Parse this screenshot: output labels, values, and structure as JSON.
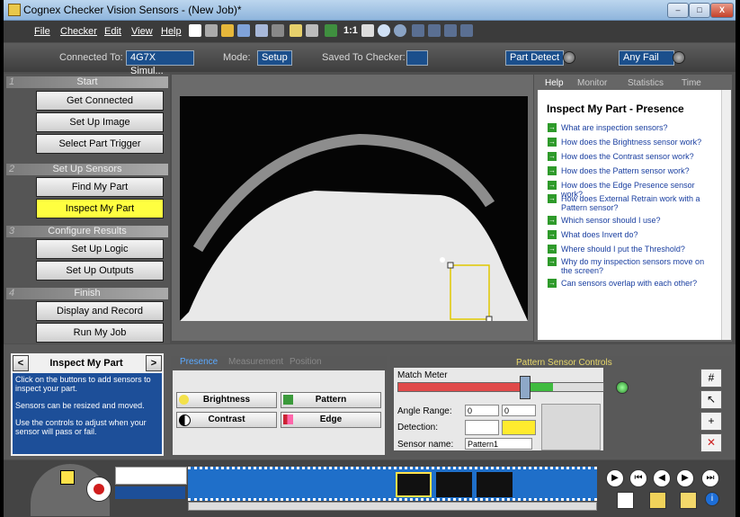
{
  "window": {
    "title": "Cognex Checker Vision Sensors - (New Job)*",
    "controls": [
      "–",
      "□",
      "X"
    ]
  },
  "menu": {
    "items": [
      "File",
      "Checker",
      "Edit",
      "View",
      "Help"
    ],
    "zoom_label": "1:1"
  },
  "status": {
    "connected_label": "Connected To:",
    "connected_value": "4G7X Simul...",
    "mode_label": "Mode:",
    "mode_value": "Setup",
    "saved_label": "Saved To Checker:",
    "saved_value": "",
    "part_detect": "Part Detect",
    "any_fail": "Any Fail"
  },
  "steps": [
    {
      "num": "1",
      "title": "Start",
      "buttons": [
        "Get Connected",
        "Set Up Image",
        "Select Part Trigger"
      ]
    },
    {
      "num": "2",
      "title": "Set Up Sensors",
      "buttons": [
        "Find My Part",
        "Inspect My Part"
      ]
    },
    {
      "num": "3",
      "title": "Configure Results",
      "buttons": [
        "Set Up Logic",
        "Set Up Outputs"
      ]
    },
    {
      "num": "4",
      "title": "Finish",
      "buttons": [
        "Display and Record",
        "Run My Job"
      ]
    }
  ],
  "right_tabs": [
    "Help",
    "Monitor",
    "Statistics",
    "Time"
  ],
  "help": {
    "title": "Inspect My Part - Presence",
    "links": [
      "What are inspection sensors?",
      "How does the Brightness sensor work?",
      "How does the Contrast sensor work?",
      "How does the Pattern sensor work?",
      "How does the Edge Presence sensor work?",
      "How does External Retrain work with a Pattern sensor?",
      "Which sensor should I use?",
      "What does Invert do?",
      "Where should I put the Threshold?",
      "Why do my inspection sensors move on the screen?",
      "Can sensors overlap with each other?"
    ]
  },
  "nav": {
    "prev": "<",
    "next": ">",
    "title": "Inspect My Part",
    "desc": [
      "Click on the buttons to add sensors to inspect your part.",
      "Sensors can be resized and moved.",
      "Use the controls to adjust when your sensor will pass or fail."
    ]
  },
  "sensor_tabs": [
    "Presence",
    "Measurement",
    "Position"
  ],
  "sensors": [
    "Brightness",
    "Pattern",
    "Contrast",
    "Edge"
  ],
  "controls": {
    "title": "Pattern Sensor Controls",
    "match_meter": "Match Meter",
    "match_value": 0.67,
    "threshold": 0.62,
    "angle_label": "Angle Range:",
    "angle_min": "0",
    "angle_max": "0",
    "detection_label": "Detection:",
    "sensor_name_label": "Sensor name:",
    "sensor_name": "Pattern1"
  },
  "colors": {
    "accent_yellow": "#ffff40",
    "blue_panel": "#1d4f99",
    "status_blue": "#1b4f8c",
    "help_link": "#1a3fa0"
  }
}
